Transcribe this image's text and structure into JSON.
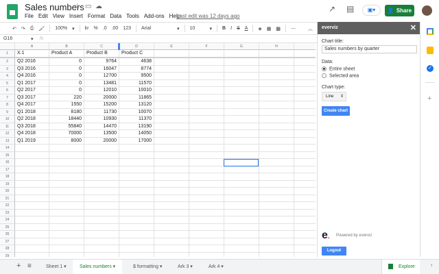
{
  "doc": {
    "title": "Sales numbers",
    "last_edit": "Last edit was 12 days ago",
    "share": "Share"
  },
  "menu": [
    "File",
    "Edit",
    "View",
    "Insert",
    "Format",
    "Data",
    "Tools",
    "Add-ons",
    "Help"
  ],
  "toolbar": {
    "zoom": "100%",
    "currency": "kr",
    "percent": "%",
    "dec_less": ".0",
    "dec_more": ".00",
    "format": "123",
    "font": "Arial",
    "size": "10",
    "bold": "B",
    "italic": "I",
    "strike": "S",
    "textcolor": "A",
    "more": "⋯"
  },
  "formula_bar": {
    "cell_ref": "G16",
    "fx": "fx",
    "value": ""
  },
  "columns": [
    "A",
    "B",
    "C",
    "D",
    "E",
    "F",
    "G",
    "H"
  ],
  "header_row": [
    "X.1",
    "Product A",
    "Product B",
    "Product C"
  ],
  "rows": [
    [
      "Q2 2016",
      "0",
      "9764",
      "4638"
    ],
    [
      "Q3 2016",
      "0",
      "16047",
      "8774"
    ],
    [
      "Q4 2016",
      "0",
      "12700",
      "9500"
    ],
    [
      "Q1 2017",
      "0",
      "13481",
      "11570"
    ],
    [
      "Q2 2017",
      "0",
      "12010",
      "10010"
    ],
    [
      "Q3 2017",
      "220",
      "20000",
      "11865"
    ],
    [
      "Q4 2017",
      "1550",
      "15200",
      "13120"
    ],
    [
      "Q1 2018",
      "8180",
      "11730",
      "10070"
    ],
    [
      "Q2 2018",
      "18440",
      "10930",
      "11370"
    ],
    [
      "Q3 2018",
      "55840",
      "14470",
      "13190"
    ],
    [
      "Q4 2018",
      "70000",
      "13500",
      "14050"
    ],
    [
      "Q1 2019",
      "8000",
      "20000",
      "17000"
    ]
  ],
  "panel": {
    "title": "everviz",
    "chart_title_label": "Chart title:",
    "chart_title_value": "Sales numbers by quarter",
    "data_label": "Data:",
    "opt_entire": "Entire sheet",
    "opt_selected": "Selected area",
    "chart_type_label": "Chart type:",
    "chart_type": "Line",
    "create": "Create chart",
    "powered": "Powered by everviz",
    "logout": "Logout"
  },
  "sheets": [
    {
      "label": "Sheet 1"
    },
    {
      "label": "Sales numbers",
      "active": true
    },
    {
      "label": "$ formatting"
    },
    {
      "label": "Ark 3"
    },
    {
      "label": "Ark 4"
    }
  ],
  "explore": "Explore",
  "colors": {
    "green": "#188038",
    "blue": "#4285f4",
    "panel_header": "#5f5f5f"
  }
}
